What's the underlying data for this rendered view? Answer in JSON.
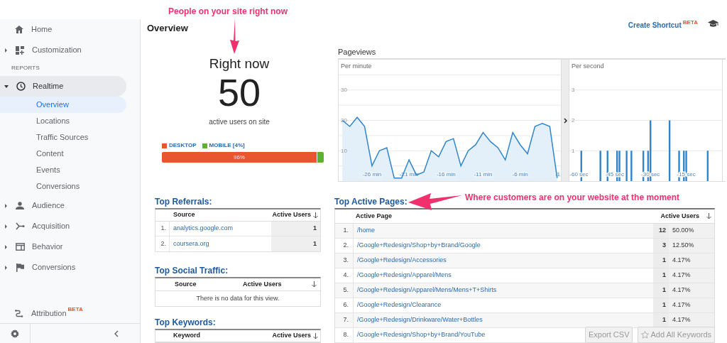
{
  "sidebar": {
    "items": [
      {
        "label": "Home",
        "selected": false
      },
      {
        "label": "Customization",
        "expanded": false,
        "selected": false
      }
    ],
    "section_label": "REPORTS",
    "report_items": [
      {
        "label": "Realtime",
        "expanded": true,
        "selected": true,
        "children": [
          {
            "label": "Overview",
            "selected": true
          },
          {
            "label": "Locations",
            "selected": false
          },
          {
            "label": "Traffic Sources",
            "selected": false
          },
          {
            "label": "Content",
            "selected": false
          },
          {
            "label": "Events",
            "selected": false
          },
          {
            "label": "Conversions",
            "selected": false
          }
        ]
      },
      {
        "label": "Audience",
        "expanded": false,
        "selected": false
      },
      {
        "label": "Acquisition",
        "expanded": false,
        "selected": false
      },
      {
        "label": "Behavior",
        "expanded": false,
        "selected": false
      },
      {
        "label": "Conversions",
        "expanded": false,
        "selected": false
      }
    ],
    "attribution": {
      "label": "Attribution",
      "badge": "BETA"
    }
  },
  "header": {
    "title": "Overview",
    "shortcut": {
      "label": "Create Shortcut",
      "badge": "BETA"
    }
  },
  "right_now": {
    "callout": "People on your site right now",
    "title": "Right now",
    "count": "50",
    "caption": "active users on site",
    "devices": [
      {
        "label": "DESKTOP",
        "color": "#e8552f",
        "level": 0.96,
        "bar_label": "96%"
      },
      {
        "label": "MOBILE [4%]",
        "color": "#5cb230",
        "level": 0.04
      }
    ]
  },
  "pageviews": {
    "title": "Pageviews",
    "charts": [
      {
        "label": "Per minute",
        "chart_data": {
          "type": "area",
          "x": [
            -30,
            -29,
            -28,
            -27,
            -26,
            -25,
            -24,
            -23,
            -22,
            -21,
            -20,
            -19,
            -18,
            -17,
            -16,
            -15,
            -14,
            -13,
            -12,
            -11,
            -10,
            -9,
            -8,
            -7,
            -6,
            -5,
            -4,
            -3,
            -2,
            -1
          ],
          "series": [
            {
              "color": "#2f86cc",
              "values": [
                20,
                18,
                21,
                18,
                5,
                10,
                11,
                1,
                1,
                7,
                2,
                3,
                10,
                8,
                13,
                14,
                5,
                10,
                12,
                16,
                13,
                11,
                7,
                16,
                12,
                9,
                18,
                19,
                18,
                1
              ]
            }
          ],
          "grid": true,
          "xlim": [
            -30.5,
            -0.5
          ],
          "ylim": [
            0,
            40
          ],
          "yticks": [
            10,
            20,
            30
          ],
          "xticks": [
            {
              "value": -26,
              "label": "-26 min"
            },
            {
              "value": -21,
              "label": "-21 min"
            },
            {
              "value": -16,
              "label": "-16 min"
            },
            {
              "value": -11,
              "label": "-11 min"
            },
            {
              "value": -6,
              "label": "-6 min"
            },
            {
              "value": -1,
              "label": "-1"
            }
          ]
        }
      },
      {
        "label": "Per second",
        "chart_data": {
          "type": "bar",
          "x": [
            -59,
            -51,
            -48,
            -44,
            -43,
            -40,
            -38,
            -33,
            -31,
            -30,
            -22,
            -18,
            -16,
            -15,
            -6
          ],
          "series": [
            {
              "color": "#2f86cc",
              "values": [
                1,
                1,
                1,
                1,
                1,
                1,
                1,
                1,
                1,
                2,
                2,
                1,
                1,
                1,
                1
              ]
            }
          ],
          "grid": true,
          "xlim": [
            -64,
            0
          ],
          "ylim": [
            0,
            4
          ],
          "yticks": [
            1,
            2,
            3
          ],
          "xticks": [
            {
              "value": -60,
              "label": "-60 sec"
            },
            {
              "value": -45,
              "label": "-45 sec"
            },
            {
              "value": -30,
              "label": "-30 sec"
            },
            {
              "value": -15,
              "label": "-15 sec"
            }
          ]
        }
      }
    ]
  },
  "top_referrals": {
    "title": "Top Referrals:",
    "columns": [
      "Source",
      "Active Users"
    ],
    "rows": [
      {
        "rank": "1.",
        "source": "analytics.google.com",
        "users": "1"
      },
      {
        "rank": "2.",
        "source": "coursera.org",
        "users": "1"
      }
    ]
  },
  "top_social": {
    "title": "Top Social Traffic:",
    "columns": [
      "Source",
      "Active Users"
    ],
    "empty_message": "There is no data for this view."
  },
  "top_keywords": {
    "title": "Top Keywords:",
    "columns": [
      "Keyword",
      "Active Users"
    ]
  },
  "top_pages": {
    "title": "Top Active Pages:",
    "callout": "Where customers are on your website at the moment",
    "columns": [
      "Active Page",
      "Active Users"
    ],
    "rows": [
      {
        "rank": "1.",
        "page": "/home",
        "users": "12",
        "percent": "50.00%"
      },
      {
        "rank": "2.",
        "page": "/Google+Redesign/Shop+by+Brand/Google",
        "users": "3",
        "percent": "12.50%"
      },
      {
        "rank": "3.",
        "page": "/Google+Redesign/Accessories",
        "users": "1",
        "percent": "4.17%"
      },
      {
        "rank": "4.",
        "page": "/Google+Redesign/Apparel/Mens",
        "users": "1",
        "percent": "4.17%"
      },
      {
        "rank": "5.",
        "page": "/Google+Redesign/Apparel/Mens/Mens+T+Shirts",
        "users": "1",
        "percent": "4.17%"
      },
      {
        "rank": "6.",
        "page": "/Google+Redesign/Clearance",
        "users": "1",
        "percent": "4.17%"
      },
      {
        "rank": "7.",
        "page": "/Google+Redesign/Drinkware/Water+Bottles",
        "users": "1",
        "percent": "4.17%"
      },
      {
        "rank": "8.",
        "page": "/Google+Redesign/Shop+by+Brand/YouTube"
      }
    ]
  },
  "buttons": [
    {
      "label": "Export CSV",
      "disabled": true
    },
    {
      "label": "Add All Keywords",
      "disabled": true
    }
  ]
}
